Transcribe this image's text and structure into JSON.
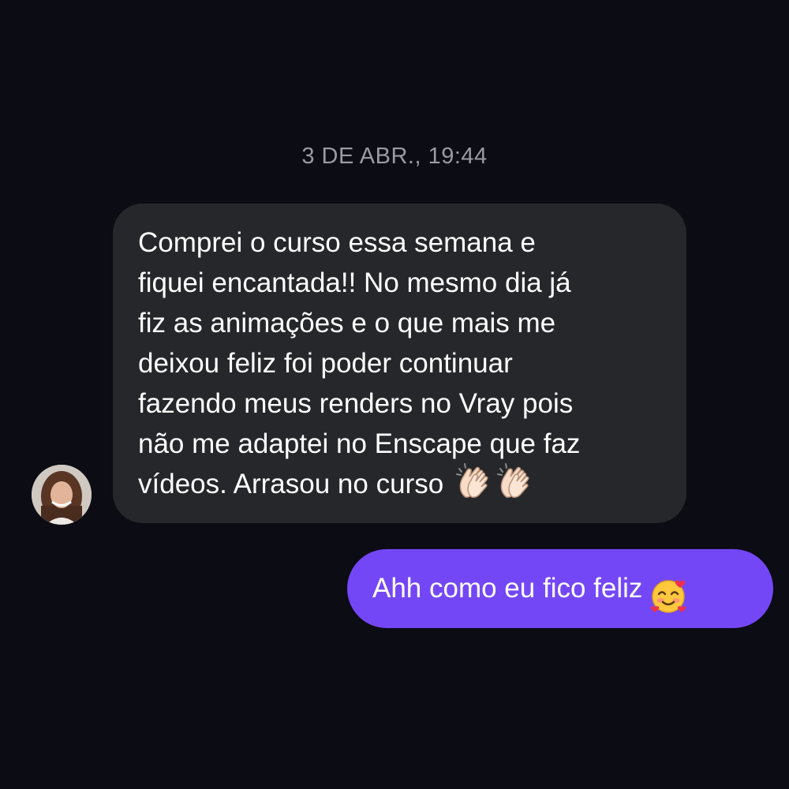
{
  "timestamp": "3 DE ABR., 19:44",
  "incoming_message": {
    "lines": [
      "Comprei o curso essa semana e",
      "fiquei encantada!! No mesmo dia já",
      "fiz as animações e o que mais me",
      "deixou feliz foi poder continuar",
      "fazendo meus renders no Vray pois",
      "não me adaptei no Enscape que faz",
      "vídeos. Arrasou no curso"
    ],
    "emojis": [
      "clapping-hands-icon",
      "clapping-hands-icon"
    ]
  },
  "outgoing_message": {
    "text": "Ahh como eu fico feliz",
    "emoji": "smiling-face-with-hearts-icon"
  },
  "colors": {
    "background": "#0b0c14",
    "incoming_bubble": "#26272b",
    "outgoing_bubble": "#7447f6",
    "timestamp_text": "#9a9aa2",
    "message_text": "#ffffff"
  }
}
